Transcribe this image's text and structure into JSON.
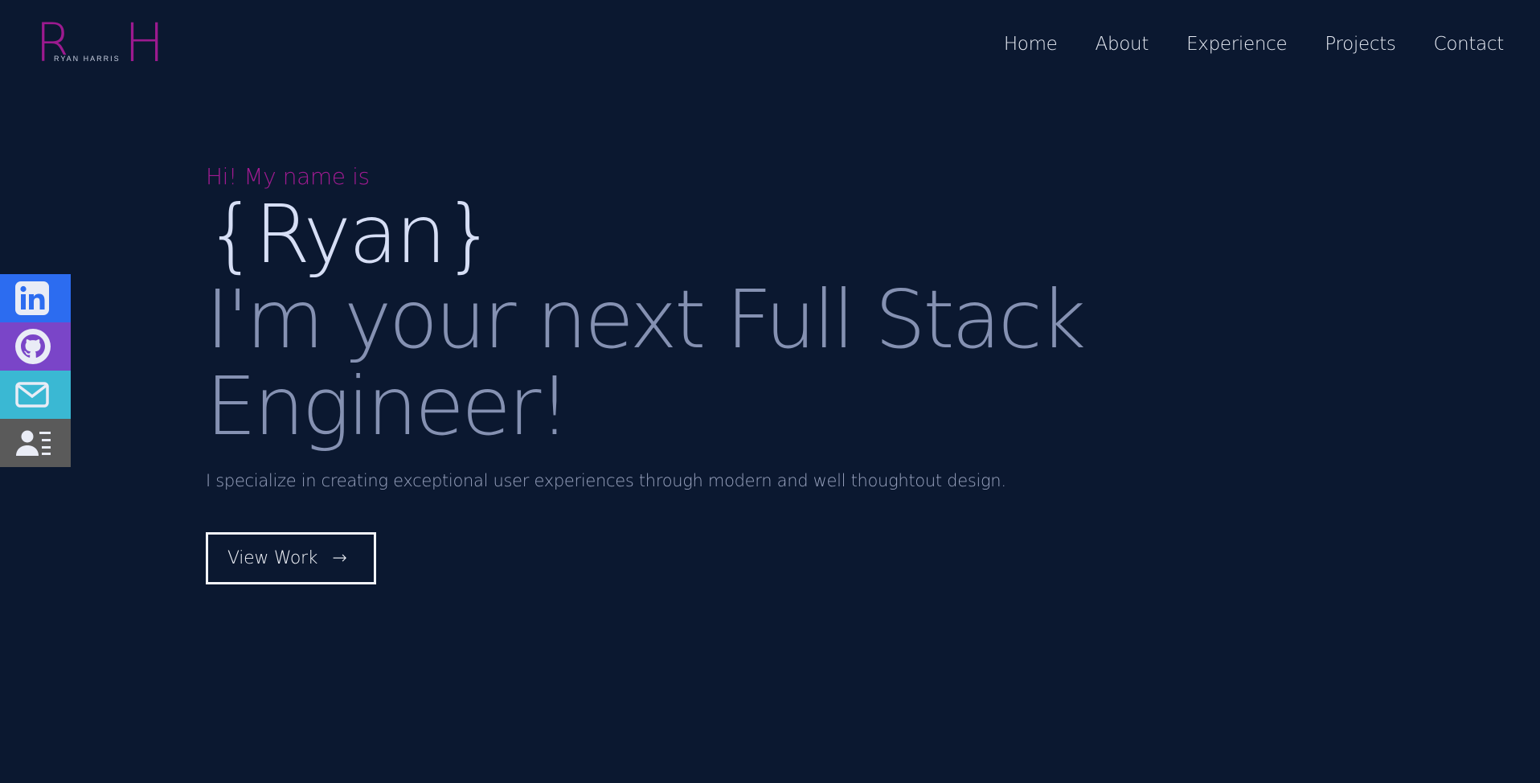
{
  "logo": {
    "letters": "R H",
    "subtitle": "RYAN HARRIS"
  },
  "nav": {
    "items": [
      "Home",
      "About",
      "Experience",
      "Projects",
      "Contact"
    ]
  },
  "social": {
    "items": [
      {
        "icon": "linkedin-icon",
        "color": "#2c6cf0"
      },
      {
        "icon": "github-icon",
        "color": "#7a45c8"
      },
      {
        "icon": "mail-icon",
        "color": "#3ab8d3"
      },
      {
        "icon": "contact-card-icon",
        "color": "#5a5a5a"
      }
    ]
  },
  "hero": {
    "intro": "Hi! My name is",
    "name": "{Ryan}",
    "tagline": "I'm your next Full Stack Engineer!",
    "description": "I specialize in creating exceptional user experiences through modern and well thoughtout design.",
    "cta_label": "View Work",
    "cta_arrow": "→"
  },
  "colors": {
    "background": "#0b1830",
    "accent": "#a01b91",
    "name": "#d6def5",
    "tagline": "#8591b2"
  }
}
